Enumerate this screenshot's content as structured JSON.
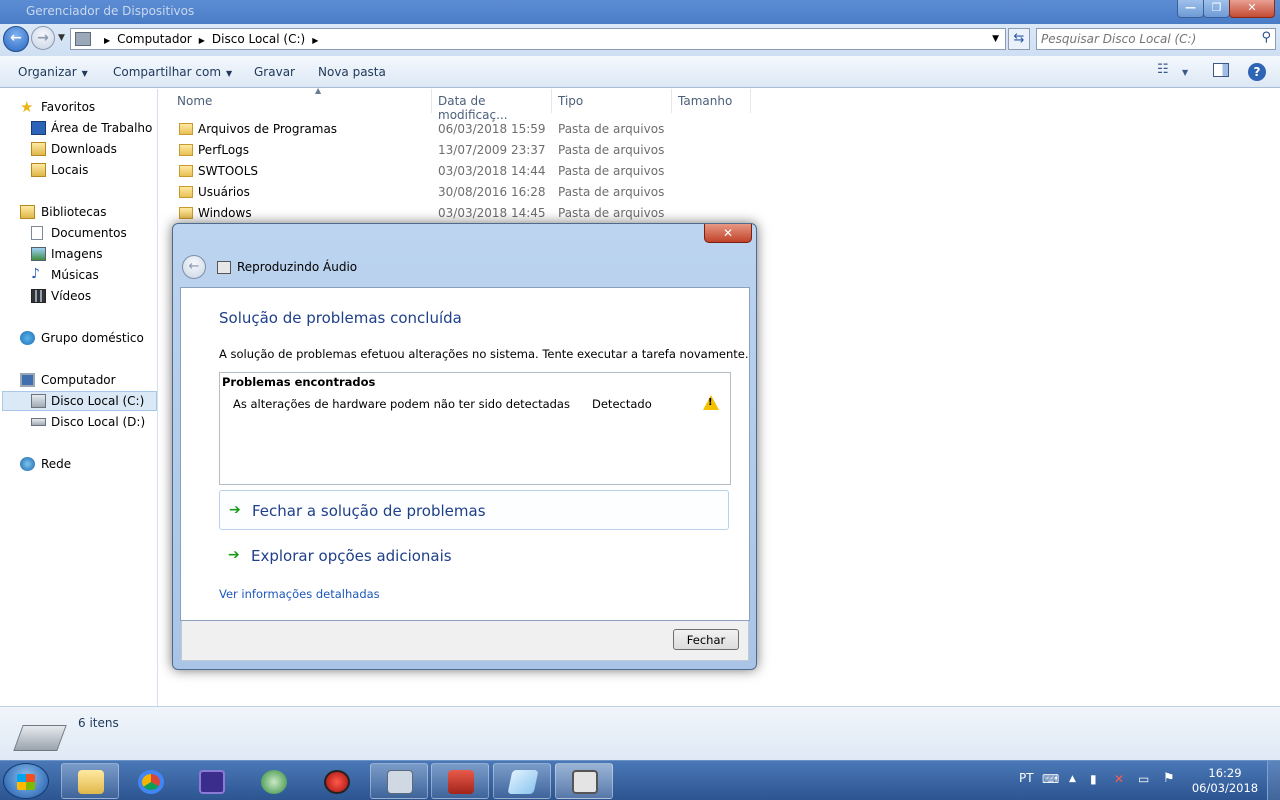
{
  "window": {
    "title": "Gerenciador de Dispositivos",
    "min_glyph": "—",
    "max_glyph": "❐",
    "close_glyph": "✕"
  },
  "address": {
    "crumbs": [
      "Computador",
      "Disco Local (C:)"
    ],
    "search_placeholder": "Pesquisar Disco Local (C:)"
  },
  "toolbar": {
    "organize": "Organizar",
    "share": "Compartilhar com",
    "burn": "Gravar",
    "new_folder": "Nova pasta"
  },
  "navpane": {
    "favorites": "Favoritos",
    "desktop": "Área de Trabalho",
    "downloads": "Downloads",
    "places": "Locais",
    "libraries": "Bibliotecas",
    "documents": "Documentos",
    "images": "Imagens",
    "music": "Músicas",
    "videos": "Vídeos",
    "homegroup": "Grupo doméstico",
    "computer": "Computador",
    "drive_c": "Disco Local (C:)",
    "drive_d": "Disco Local (D:)",
    "network": "Rede"
  },
  "filelist": {
    "columns": [
      "Nome",
      "Data de modificaç...",
      "Tipo",
      "Tamanho"
    ],
    "rows": [
      {
        "name": "Arquivos de Programas",
        "date": "06/03/2018 15:59",
        "type": "Pasta de arquivos"
      },
      {
        "name": "PerfLogs",
        "date": "13/07/2009 23:37",
        "type": "Pasta de arquivos"
      },
      {
        "name": "SWTOOLS",
        "date": "03/03/2018 14:44",
        "type": "Pasta de arquivos"
      },
      {
        "name": "Usuários",
        "date": "30/08/2016 16:28",
        "type": "Pasta de arquivos"
      },
      {
        "name": "Windows",
        "date": "03/03/2018 14:45",
        "type": "Pasta de arquivos"
      }
    ]
  },
  "status": {
    "item_count": "6 itens"
  },
  "dialog": {
    "title": "Reproduzindo Áudio",
    "heading": "Solução de problemas concluída",
    "description": "A solução de problemas efetuou alterações no sistema. Tente executar a tarefa novamente.",
    "problems_header": "Problemas encontrados",
    "problem_text": "As alterações de hardware podem não ter sido detectadas",
    "problem_status": "Detectado",
    "action_close": "Fechar a solução de problemas",
    "action_explore": "Explorar opções adicionais",
    "details_link": "Ver informações detalhadas",
    "close_button": "Fechar"
  },
  "taskbar": {
    "language": "PT",
    "time": "16:29",
    "date": "06/03/2018"
  },
  "colors": {
    "accent": "#1e3f8a",
    "link": "#1c57b8",
    "warning": "#f2c200",
    "action_arrow": "#1c9a1c"
  }
}
